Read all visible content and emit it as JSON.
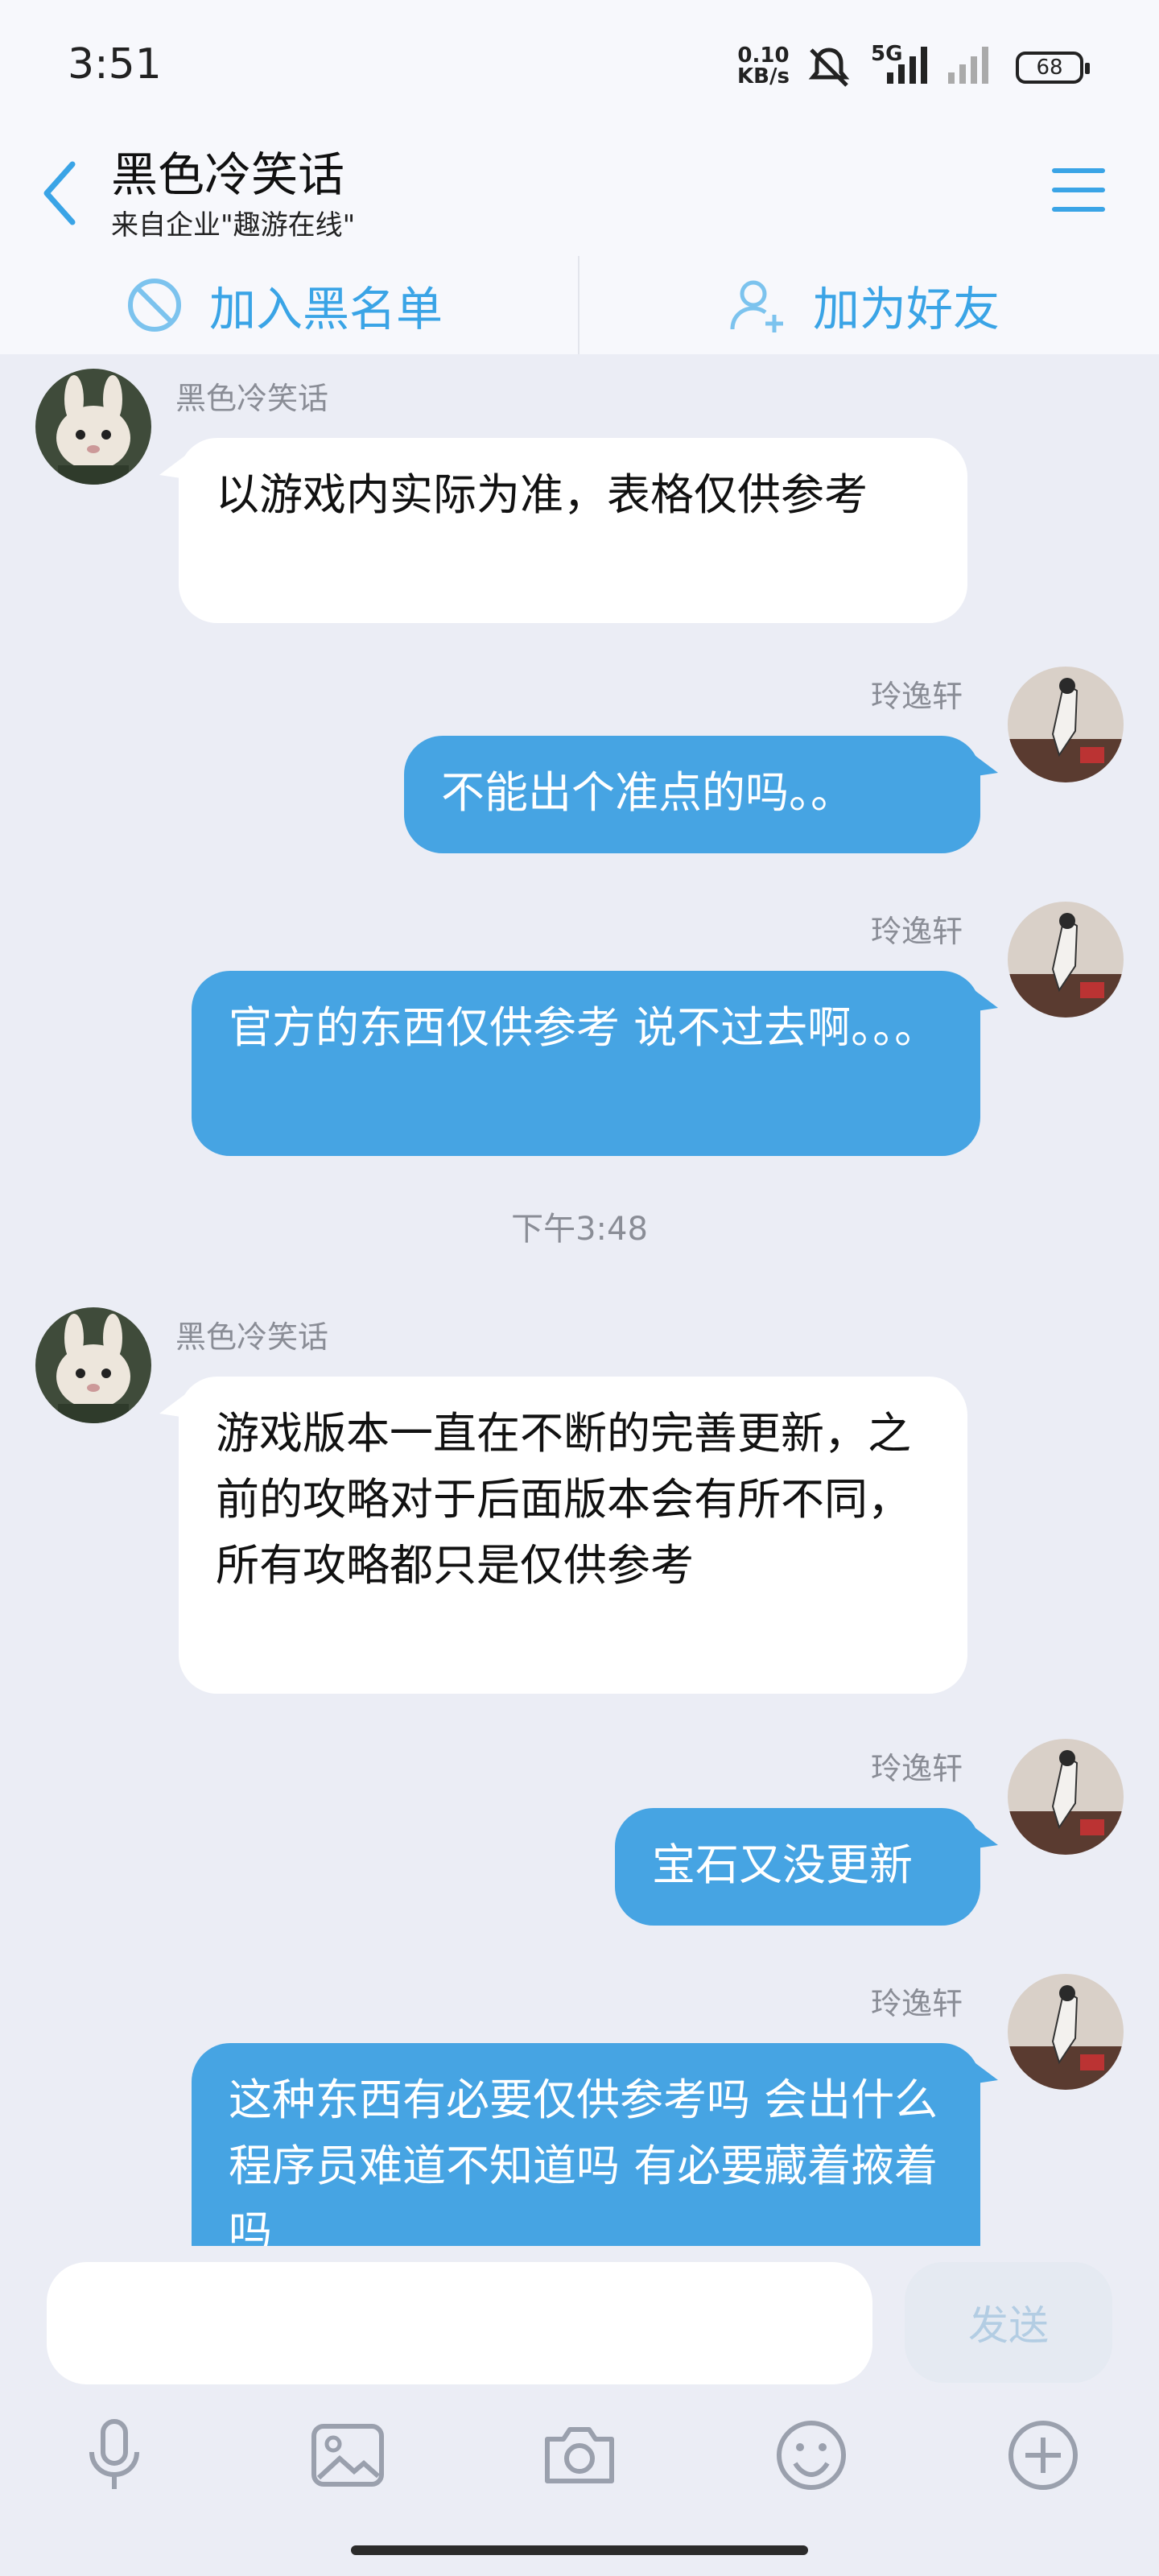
{
  "status_bar": {
    "time": "3:51",
    "net_speed_value": "0.10",
    "net_speed_unit": "KB/s",
    "network": "5G",
    "battery": "68"
  },
  "header": {
    "title": "黑色冷笑话",
    "subtitle": "来自企业\"趣游在线\""
  },
  "actions": {
    "blacklist": "加入黑名单",
    "add_friend": "加为好友"
  },
  "messages": [
    {
      "sender": "黑色冷笑话",
      "direction": "in",
      "text": "以游戏内实际为准，表格仅供参考"
    },
    {
      "sender": "玲逸轩",
      "direction": "out",
      "text": "不能出个准点的吗。。"
    },
    {
      "sender": "玲逸轩",
      "direction": "out",
      "text": "官方的东西仅供参考 说不过去啊。。。"
    },
    {
      "sender": "黑色冷笑话",
      "direction": "in",
      "text": "游戏版本一直在不断的完善更新，之前的攻略对于后面版本会有所不同，所有攻略都只是仅供参考"
    },
    {
      "sender": "玲逸轩",
      "direction": "out",
      "text": "宝石又没更新"
    },
    {
      "sender": "玲逸轩",
      "direction": "out",
      "text": "这种东西有必要仅供参考吗 会出什么程序员难道不知道吗 有必要藏着掖着吗"
    }
  ],
  "timestamp": "下午3:48",
  "composer": {
    "send_label": "发送",
    "input_value": ""
  },
  "colors": {
    "accent": "#46a4e3",
    "background": "#ebedf5",
    "incoming_bubble": "#ffffff"
  }
}
